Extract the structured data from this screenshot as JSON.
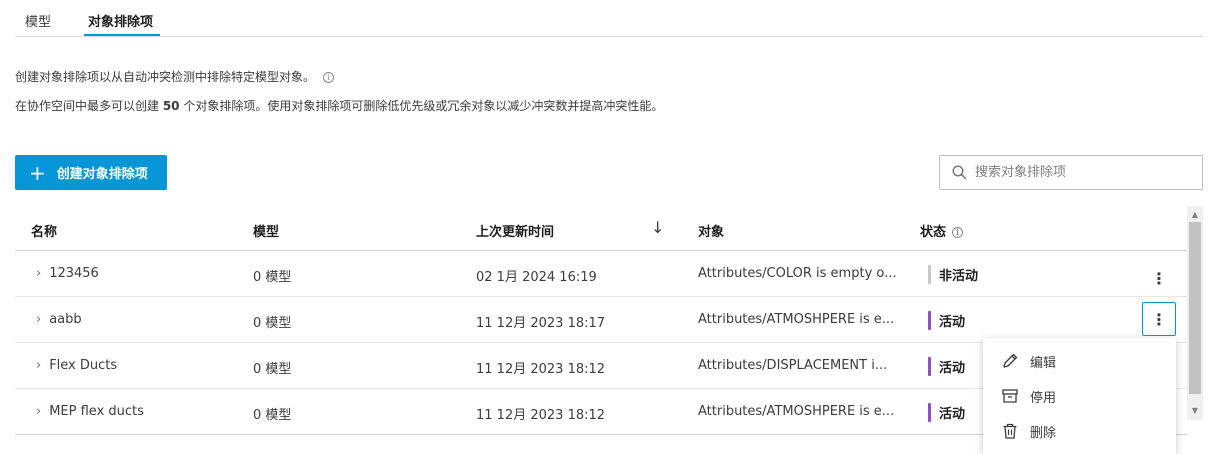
{
  "tabs": [
    {
      "label": "模型",
      "active": false
    },
    {
      "label": "对象排除项",
      "active": true
    }
  ],
  "description": {
    "line1": "创建对象排除项以从自动冲突检测中排除特定模型对象。",
    "line2_prefix": "在协作空间中最多可以创建 ",
    "line2_count": "50",
    "line2_suffix": " 个对象排除项。使用对象排除项可删除低优先级或冗余对象以减少冲突数并提高冲突性能。"
  },
  "create_button": {
    "label": "创建对象排除项",
    "icon": "plus-icon"
  },
  "search": {
    "placeholder": "搜索对象排除项",
    "value": ""
  },
  "table": {
    "headers": {
      "name": "名称",
      "model": "模型",
      "updated": "上次更新时间",
      "object": "对象",
      "status": "状态"
    },
    "sort": {
      "column": "updated",
      "direction": "descending",
      "icon": "arrow-down-icon"
    },
    "rows": [
      {
        "name": "123456",
        "model": "0 模型",
        "updated": "02 1月 2024 16:19",
        "object": "Attributes/COLOR is empty o...",
        "status": "非活动",
        "status_color": "#c8c8c8"
      },
      {
        "name": "aabb",
        "model": "0 模型",
        "updated": "11 12月 2023 18:17",
        "object": "Attributes/ATMOSHPERE is e...",
        "status": "活动",
        "status_color": "#8a4fc7"
      },
      {
        "name": "Flex Ducts",
        "model": "0 模型",
        "updated": "11 12月 2023 18:12",
        "object": "Attributes/DISPLACEMENT i...",
        "status": "活动",
        "status_color": "#8a4fc7"
      },
      {
        "name": "MEP flex ducts",
        "model": "0 模型",
        "updated": "11 12月 2023 18:12",
        "object": "Attributes/ATMOSHPERE is e...",
        "status": "活动",
        "status_color": "#8a4fc7"
      }
    ]
  },
  "row_menu": {
    "items": [
      {
        "label": "编辑",
        "icon": "pencil-icon"
      },
      {
        "label": "停用",
        "icon": "archive-icon"
      },
      {
        "label": "删除",
        "icon": "trash-icon"
      }
    ]
  },
  "colors": {
    "accent": "#0696d7",
    "active_status": "#8a4fc7",
    "inactive_status": "#c8c8c8"
  }
}
